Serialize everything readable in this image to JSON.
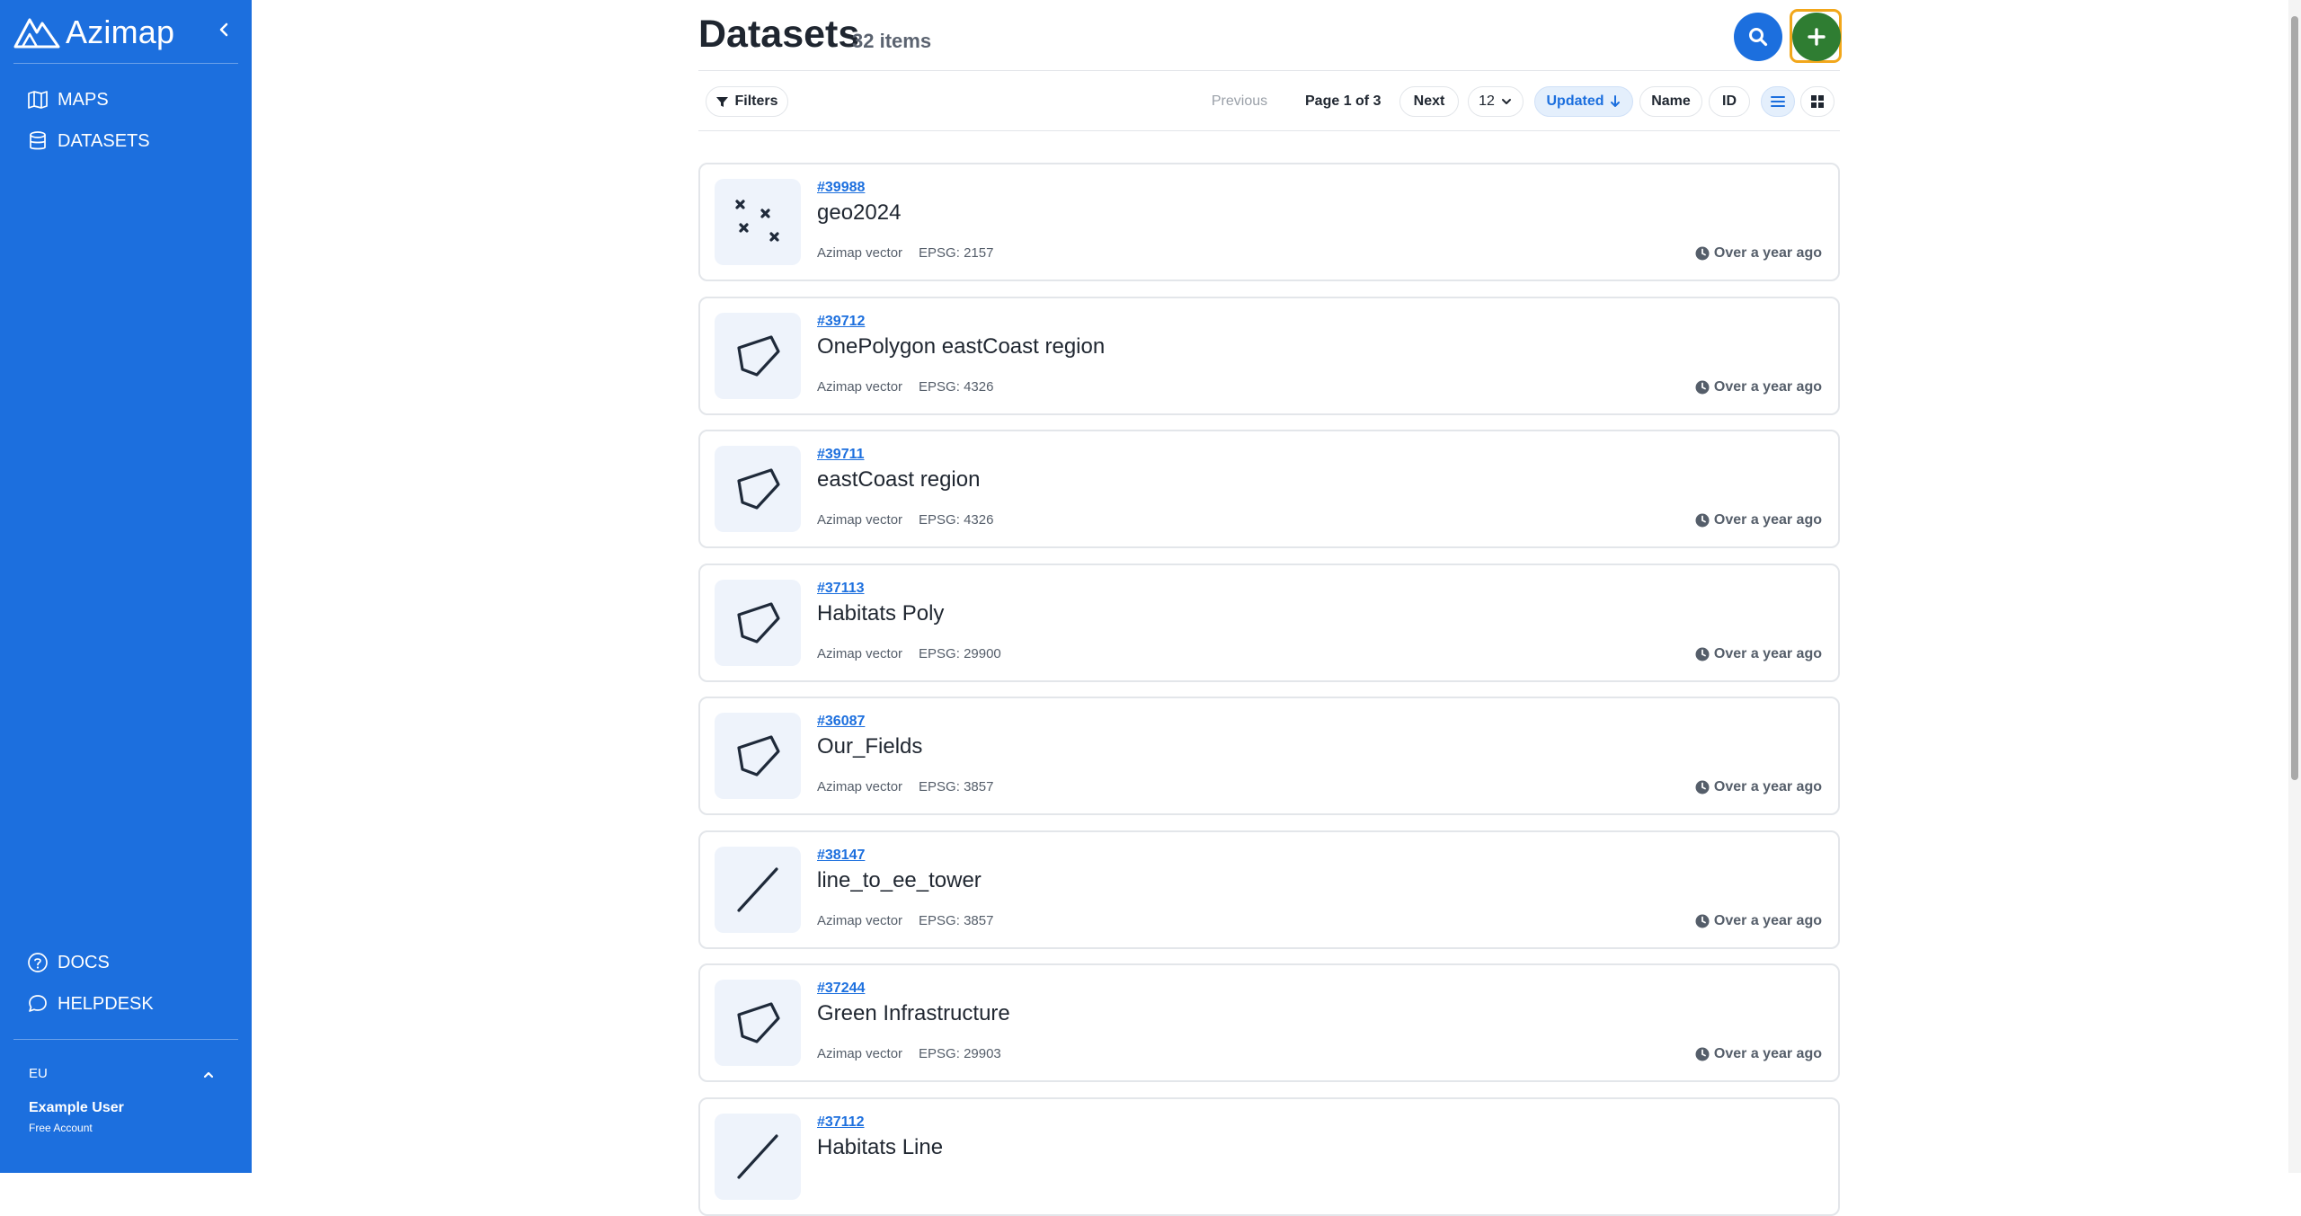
{
  "app": {
    "name": "Azimap"
  },
  "sidebar": {
    "items": [
      {
        "label": "MAPS",
        "icon": "map-icon"
      },
      {
        "label": "DATASETS",
        "icon": "database-icon"
      }
    ],
    "footer_items": [
      {
        "label": "DOCS",
        "icon": "help-circle-icon"
      },
      {
        "label": "HELPDESK",
        "icon": "chat-icon"
      }
    ],
    "region": "EU",
    "user": {
      "name": "Example User",
      "plan": "Free Account"
    },
    "color": "#1c6fde"
  },
  "header": {
    "title": "Datasets",
    "count": "32 items"
  },
  "toolbar": {
    "filters": "Filters",
    "previous": "Previous",
    "page_info": "Page 1 of 3",
    "next": "Next",
    "page_size": "12",
    "sort_updated": "Updated",
    "sort_name": "Name",
    "sort_id": "ID"
  },
  "datasets": [
    {
      "id": "#39988",
      "name": "geo2024",
      "type": "Azimap vector",
      "epsg": "EPSG: 2157",
      "updated": "Over a year ago",
      "geometry": "points"
    },
    {
      "id": "#39712",
      "name": "OnePolygon eastCoast region",
      "type": "Azimap vector",
      "epsg": "EPSG: 4326",
      "updated": "Over a year ago",
      "geometry": "polygon"
    },
    {
      "id": "#39711",
      "name": "eastCoast region",
      "type": "Azimap vector",
      "epsg": "EPSG: 4326",
      "updated": "Over a year ago",
      "geometry": "polygon"
    },
    {
      "id": "#37113",
      "name": "Habitats Poly",
      "type": "Azimap vector",
      "epsg": "EPSG: 29900",
      "updated": "Over a year ago",
      "geometry": "polygon"
    },
    {
      "id": "#36087",
      "name": "Our_Fields",
      "type": "Azimap vector",
      "epsg": "EPSG: 3857",
      "updated": "Over a year ago",
      "geometry": "polygon"
    },
    {
      "id": "#38147",
      "name": "line_to_ee_tower",
      "type": "Azimap vector",
      "epsg": "EPSG: 3857",
      "updated": "Over a year ago",
      "geometry": "line"
    },
    {
      "id": "#37244",
      "name": "Green Infrastructure",
      "type": "Azimap vector",
      "epsg": "EPSG: 29903",
      "updated": "Over a year ago",
      "geometry": "polygon"
    },
    {
      "id": "#37112",
      "name": "Habitats Line",
      "type": "",
      "epsg": "",
      "updated": "",
      "geometry": "line"
    }
  ]
}
